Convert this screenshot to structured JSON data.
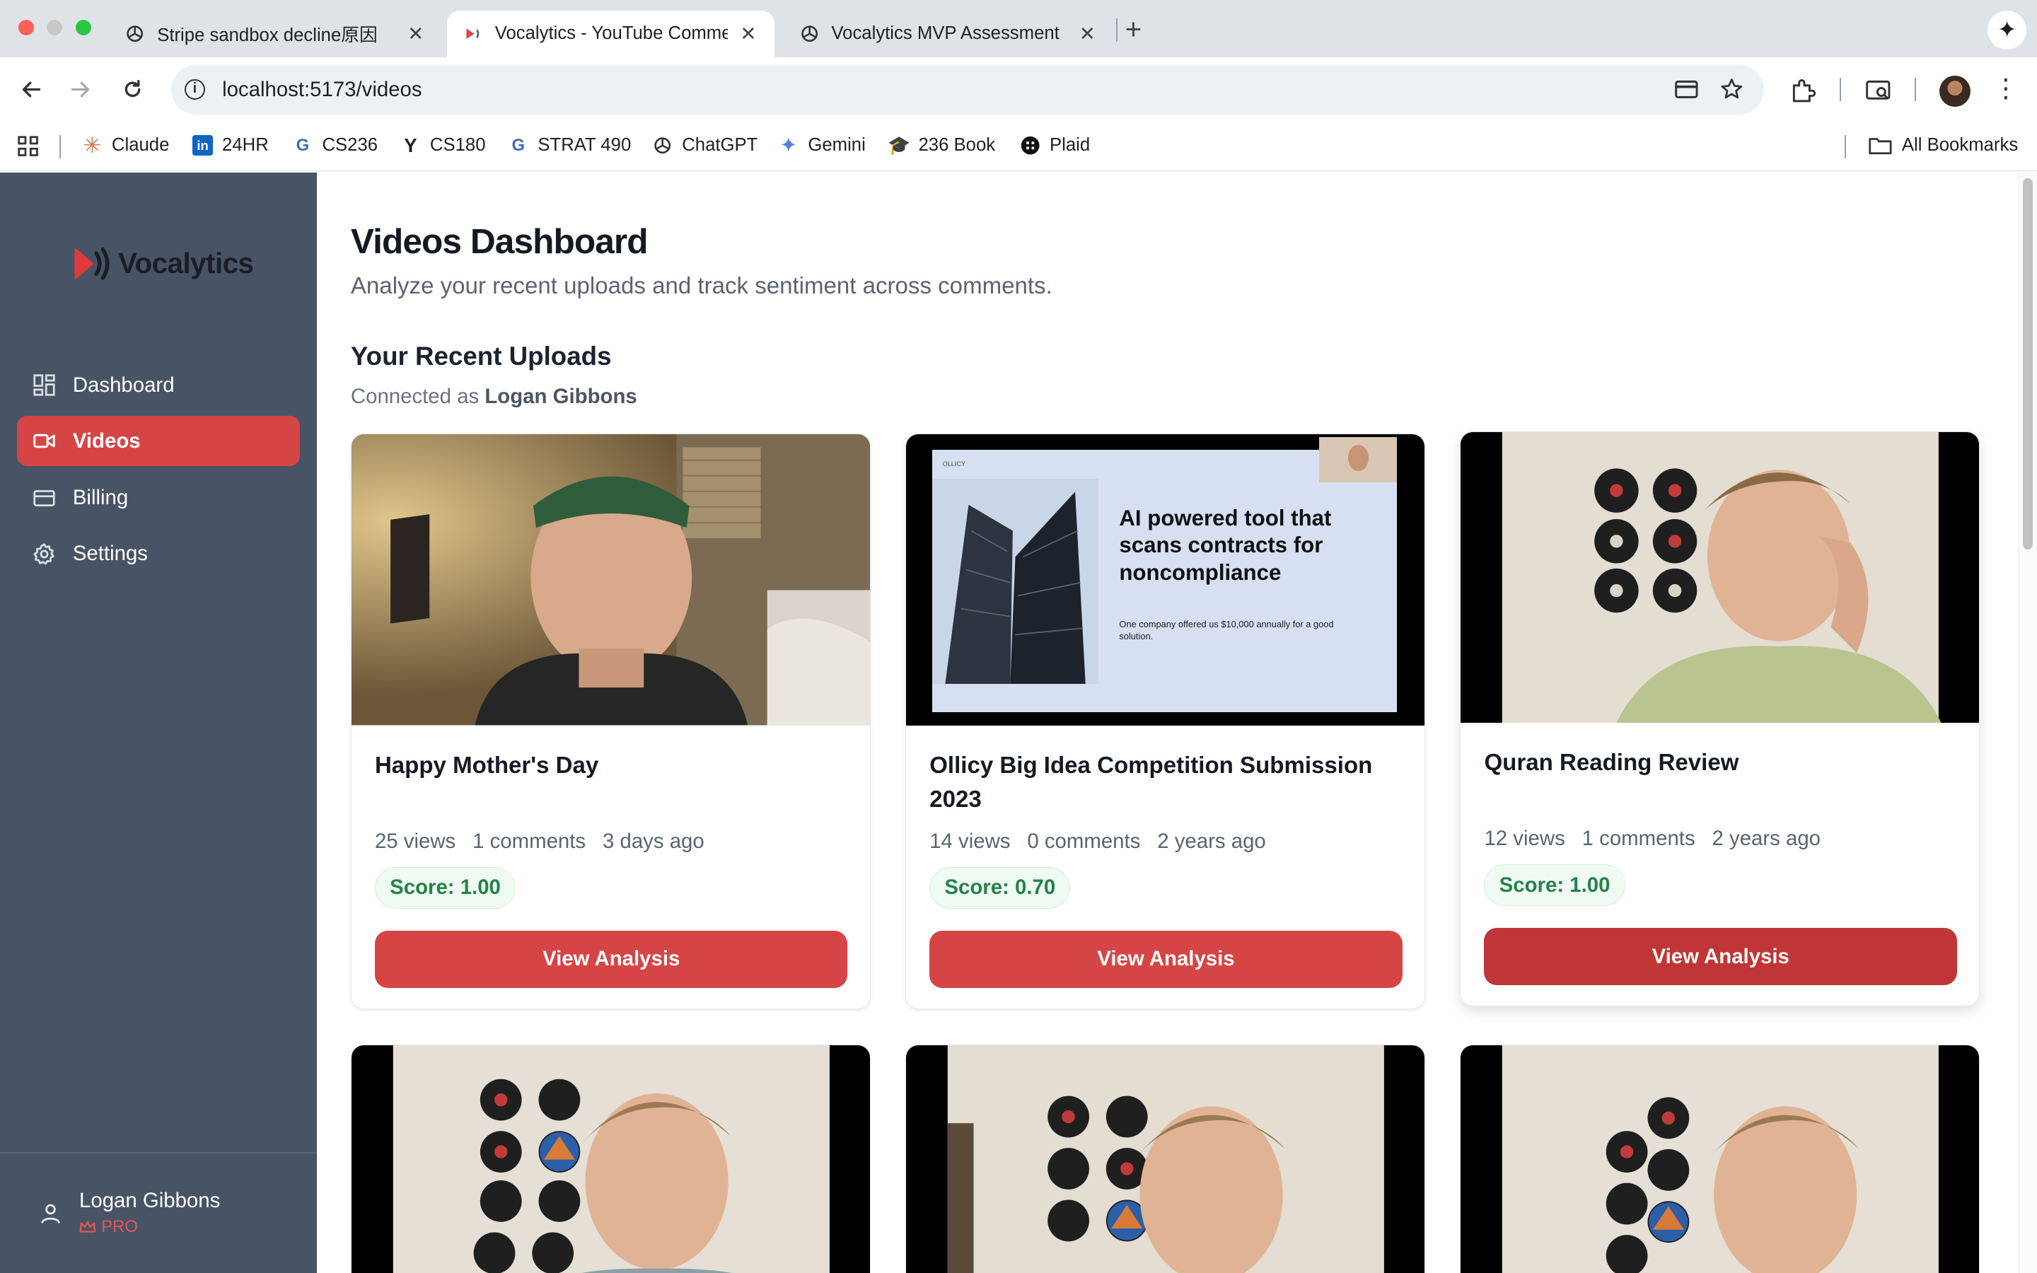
{
  "browser": {
    "tabs": [
      {
        "title": "Stripe sandbox decline原因",
        "icon": "openai-icon",
        "active": false
      },
      {
        "title": "Vocalytics - YouTube Comme",
        "icon": "vocalytics-icon",
        "active": true
      },
      {
        "title": "Vocalytics MVP Assessment",
        "icon": "openai-icon",
        "active": false
      }
    ],
    "new_tab": "+",
    "url": "localhost:5173/videos",
    "bookmarks": [
      {
        "label": "Claude",
        "icon": "claude-icon"
      },
      {
        "label": "24HR",
        "icon": "linkedin-icon"
      },
      {
        "label": "CS236",
        "icon": "course-icon"
      },
      {
        "label": "CS180",
        "icon": "ycombinator-icon"
      },
      {
        "label": "STRAT 490",
        "icon": "course-icon"
      },
      {
        "label": "ChatGPT",
        "icon": "openai-icon"
      },
      {
        "label": "Gemini",
        "icon": "gemini-icon"
      },
      {
        "label": "236 Book",
        "icon": "graduation-cap-icon"
      },
      {
        "label": "Plaid",
        "icon": "plaid-icon"
      }
    ],
    "all_bookmarks": "All Bookmarks"
  },
  "sidebar": {
    "brand": "Vocalytics",
    "items": [
      {
        "label": "Dashboard",
        "icon": "dashboard-icon",
        "active": false
      },
      {
        "label": "Videos",
        "icon": "video-icon",
        "active": true
      },
      {
        "label": "Billing",
        "icon": "credit-card-icon",
        "active": false
      },
      {
        "label": "Settings",
        "icon": "gear-icon",
        "active": false
      }
    ],
    "user": {
      "name": "Logan Gibbons",
      "plan": "PRO"
    }
  },
  "main": {
    "title": "Videos Dashboard",
    "subtitle": "Analyze your recent uploads and track sentiment across comments.",
    "section_title": "Your Recent Uploads",
    "connected_prefix": "Connected as",
    "connected_user": "Logan Gibbons",
    "videos": [
      {
        "title": "Happy Mother's Day",
        "views": "25 views",
        "comments": "1 comments",
        "age": "3 days ago",
        "score": "Score: 1.00",
        "action": "View Analysis"
      },
      {
        "title": "Ollicy Big Idea Competition Submission 2023",
        "views": "14 views",
        "comments": "0 comments",
        "age": "2 years ago",
        "score": "Score: 0.70",
        "action": "View Analysis",
        "slide": {
          "heading": "AI powered tool that scans contracts for noncompliance",
          "body": "One company offered us $10,000 annually for a good solution.",
          "brand": "OLLICY"
        }
      },
      {
        "title": "Quran Reading Review",
        "views": "12 views",
        "comments": "1 comments",
        "age": "2 years ago",
        "score": "Score: 1.00",
        "action": "View Analysis"
      }
    ]
  },
  "colors": {
    "accent": "#d64545",
    "sidebar_bg": "#485466",
    "score_text": "#258248",
    "score_bg": "#eefaf2"
  }
}
